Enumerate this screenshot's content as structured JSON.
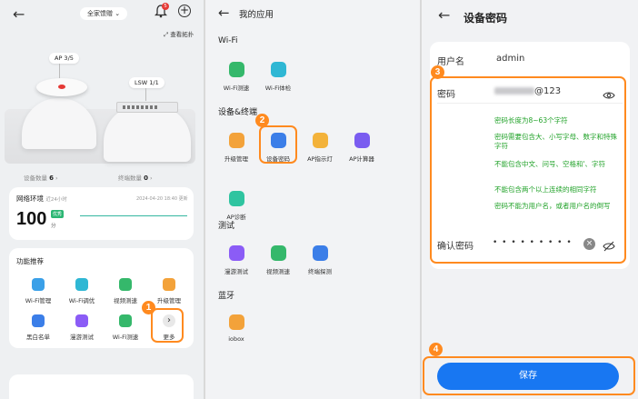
{
  "panel1": {
    "home_selector": "全家馈赠",
    "home_caret": "⌄",
    "notif_count": "5",
    "topology_link": "查看拓扑",
    "devices": [
      {
        "label": "AP 3/5"
      },
      {
        "label": "LSW 1/1"
      }
    ],
    "device_count_label": "设备数量",
    "device_count": "6",
    "terminal_count_label": "终端数量",
    "terminal_count": "0",
    "net_env_title": "网络环境",
    "net_env_sub": "近24小时",
    "net_env_time": "2024-04-20 18:40 更新",
    "score": "100",
    "score_badge": "优秀",
    "score_unit": "分",
    "func_title": "功能推荐",
    "functions": [
      {
        "label": "Wi-Fi管理",
        "color": "#3aa0e8"
      },
      {
        "label": "Wi-Fi调优",
        "color": "#2fb7d4"
      },
      {
        "label": "视频测速",
        "color": "#35b86b"
      },
      {
        "label": "升级管理",
        "color": "#f3a23a"
      },
      {
        "label": "黑白名单",
        "color": "#3b7ee8"
      },
      {
        "label": "漫游测试",
        "color": "#8b5cf6"
      },
      {
        "label": "Wi-Fi测速",
        "color": "#35b86b"
      },
      {
        "label": "更多",
        "color": "#e8e8e8"
      }
    ],
    "more_glyph": "›",
    "step1": "1"
  },
  "panel2": {
    "title": "我的应用",
    "sections": [
      {
        "name": "Wi-Fi",
        "apps": [
          {
            "label": "Wi-Fi测速",
            "color": "#35b86b"
          },
          {
            "label": "Wi-Fi体检",
            "color": "#2fb7d4"
          }
        ]
      },
      {
        "name": "设备&终端",
        "apps": [
          {
            "label": "升级管理",
            "color": "#f3a23a"
          },
          {
            "label": "设备密码",
            "color": "#3b7ee8"
          },
          {
            "label": "AP指示灯",
            "color": "#f3b23a"
          },
          {
            "label": "AP计算器",
            "color": "#7a5cf0"
          },
          {
            "label": "AP诊断",
            "color": "#2fc4a0"
          }
        ]
      },
      {
        "name": "测试",
        "apps": [
          {
            "label": "漫游测试",
            "color": "#8b5cf6"
          },
          {
            "label": "视频测速",
            "color": "#35b86b"
          },
          {
            "label": "终端探测",
            "color": "#3b7ee8"
          }
        ]
      },
      {
        "name": "蓝牙",
        "apps": [
          {
            "label": "iobox",
            "color": "#f3a23a"
          }
        ]
      }
    ],
    "step2": "2"
  },
  "panel3": {
    "title": "设备密码",
    "username_label": "用户名",
    "username_value": "admin",
    "password_label": "密码",
    "password_suffix": "@123",
    "rules": [
      "密码长度为8~63个字符",
      "密码需要包含大、小写字母、数字和特殊字符",
      "不能包含中文、问号、空格和'、字符",
      "不能包含两个以上连续的相同字符",
      "密码不能为用户名，或者用户名的倒写"
    ],
    "confirm_label": "确认密码",
    "confirm_mask": "• • • • • • • • •",
    "save_label": "保存",
    "step3": "3",
    "step4": "4"
  }
}
